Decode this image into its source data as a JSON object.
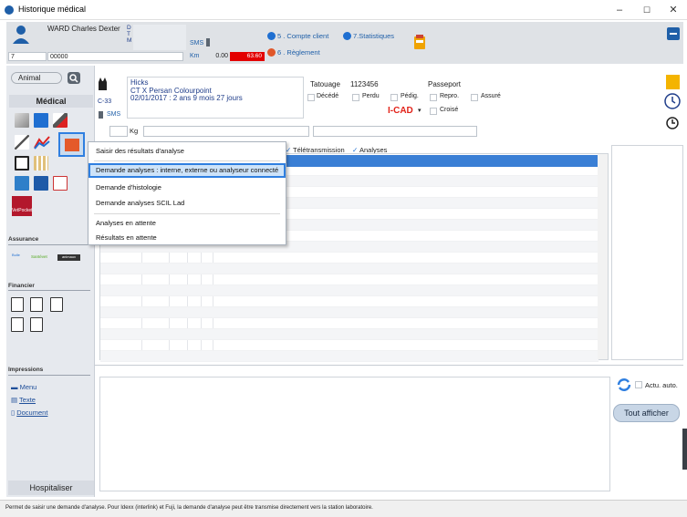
{
  "window": {
    "title": "Historique médical",
    "min": "–",
    "max": "☐",
    "close": "✕"
  },
  "header": {
    "owner_name": "WARD Charles Dexter",
    "dtm": [
      "D",
      "T",
      "M"
    ],
    "client_code": "7",
    "client_number": "00000",
    "sms_label": "SMS",
    "km_label": "Km",
    "km_value": "0.00",
    "balance": "63.60",
    "link_compte": "5 . Compte client",
    "link_stats": "7.Statistiques",
    "link_reglement": "6 . Règlement",
    "colors": {
      "blue": "#1f6fd1",
      "orange": "#e0572a",
      "red": "#e30000"
    }
  },
  "left": {
    "animal_label": "Animal",
    "medical_tab": "Médical",
    "assurance_label": "Assurance",
    "financier_label": "Financier",
    "impressions_label": "Impressions",
    "impressions_items": [
      "Menu",
      "Texte",
      "Document"
    ],
    "hospitaliser": "Hospitaliser",
    "insurance_logos": [
      "Bulle",
      "Santévet",
      "animaux"
    ],
    "vet_logo": "VetPocket"
  },
  "animal": {
    "code": "C-33",
    "sms": "SMS",
    "name": "Hicks",
    "breed": "CT X Persan Colourpoint",
    "birth": "02/01/2017 : 2 ans 9 mois 27 jours",
    "tatouage_label": "Tatouage",
    "tatouage_value": "1123456",
    "passeport_label": "Passeport",
    "flags": [
      "Décédé",
      "Perdu",
      "Pédig.",
      "Repro.",
      "Assuré"
    ],
    "icad": "I-CAD",
    "icad_dropdown": "▾",
    "croise": "Croisé",
    "weight_unit": "Kg"
  },
  "filters": {
    "teletransmission": "Télétransmission",
    "analyses": "Analyses"
  },
  "menu": {
    "items": [
      "Saisir des résultats d'analyse",
      "Demande analyses : interne, externe ou analyseur connecté",
      "Demande d'histologie",
      "Demande analyses SCIL Lad",
      "Analyses en attente",
      "Résultats en attente"
    ]
  },
  "bottom": {
    "actu_auto": "Actu. auto.",
    "tout_afficher": "Tout afficher"
  },
  "status": "Permet de saisir une demande d'analyse. Pour Idexx (interlink) et Fuji, la demande d'analyse peut être transmise directement vers la station laboratoire."
}
